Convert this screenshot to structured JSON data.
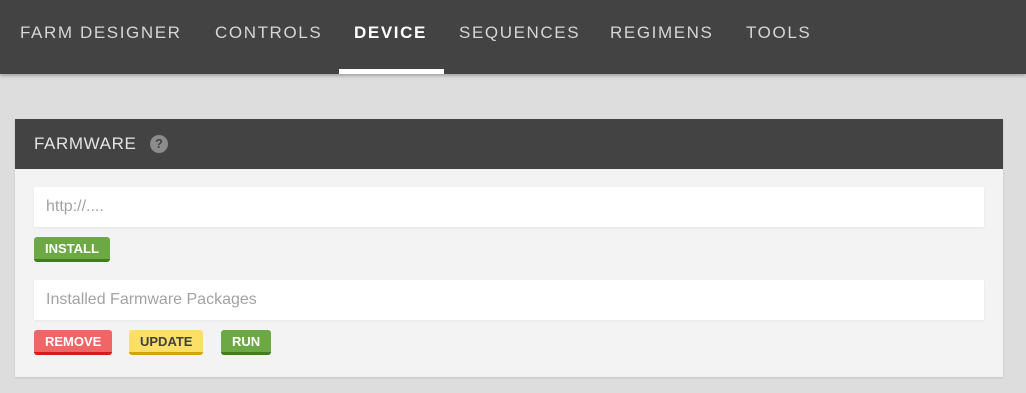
{
  "nav": {
    "items": [
      {
        "label": "FARM DESIGNER"
      },
      {
        "label": "CONTROLS"
      },
      {
        "label": "DEVICE",
        "active": true
      },
      {
        "label": "SEQUENCES"
      },
      {
        "label": "REGIMENS"
      },
      {
        "label": "TOOLS"
      }
    ]
  },
  "farmware": {
    "title": "FARMWARE",
    "help_icon": "question-circle-icon",
    "url_input": {
      "placeholder": "http://....",
      "value": ""
    },
    "install_label": "INSTALL",
    "packages_select": {
      "placeholder": "Installed Farmware Packages"
    },
    "remove_label": "REMOVE",
    "update_label": "UPDATE",
    "run_label": "RUN"
  },
  "colors": {
    "header_bg": "#434343",
    "page_bg": "#dddddd",
    "panel_bg": "#f3f3f3",
    "green": "#6ca944",
    "red": "#ee6666",
    "yellow": "#fbdf66"
  }
}
